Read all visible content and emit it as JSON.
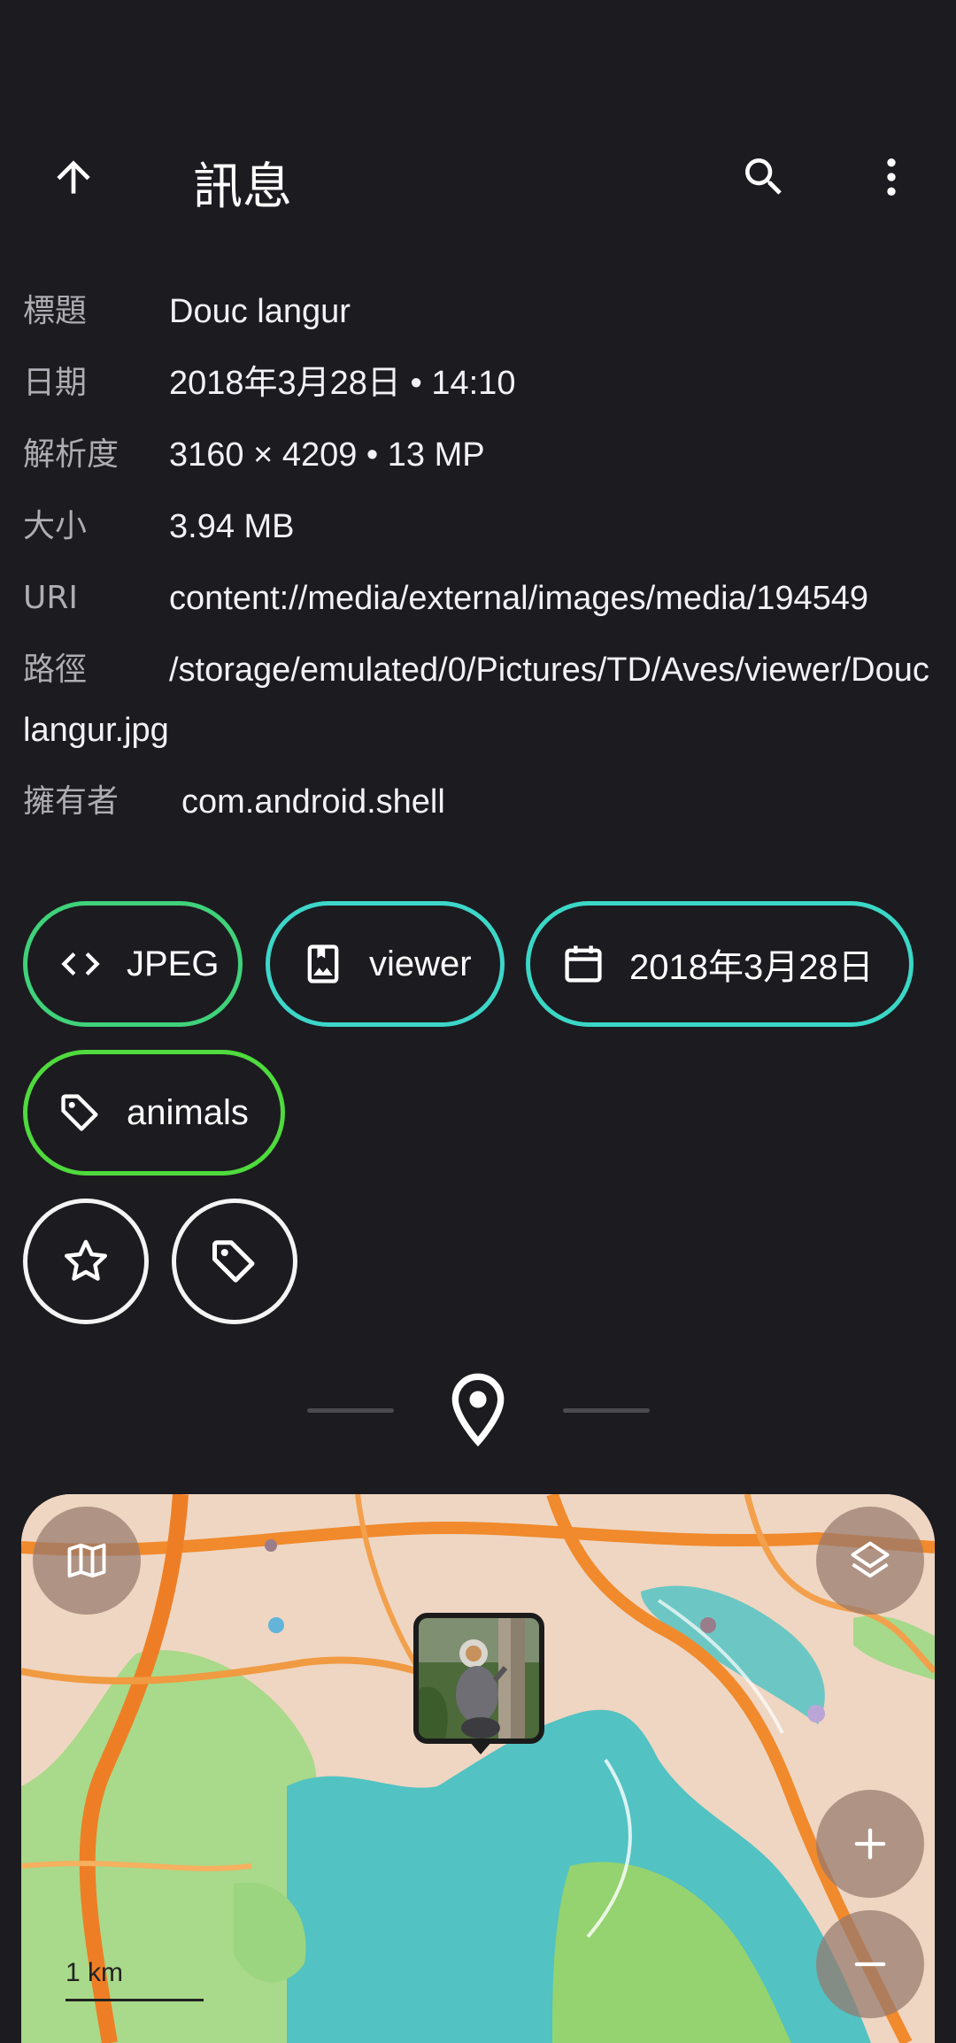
{
  "appbar": {
    "title": "訊息",
    "back_icon": "arrow-up-icon",
    "search_icon": "search-icon",
    "more_icon": "more-vert-icon"
  },
  "info": {
    "rows": [
      {
        "label": "標題",
        "value": "Douc langur"
      },
      {
        "label": "日期",
        "value": "2018年3月28日 • 14:10"
      },
      {
        "label": "解析度",
        "value": "3160 × 4209 • 13 MP"
      },
      {
        "label": "大小",
        "value": "3.94 MB"
      },
      {
        "label": "URI",
        "value": "content://media/external/images/media/194549"
      },
      {
        "label": "路徑",
        "value": "/storage/emulated/0/Pictures/TD/Aves/viewer/Douc langur.jpg"
      },
      {
        "label": "擁有者",
        "value": "com.android.shell"
      }
    ]
  },
  "chips": {
    "jpeg": {
      "label": "JPEG",
      "icon": "code-icon",
      "color": "#3fd27a"
    },
    "viewer": {
      "label": "viewer",
      "icon": "album-icon",
      "color": "#3dd6c9"
    },
    "date": {
      "label": "2018年3月28日",
      "icon": "calendar-icon",
      "color": "#3ad7c6"
    },
    "animals": {
      "label": "animals",
      "icon": "tag-icon",
      "color": "#4fda3d"
    }
  },
  "actions": {
    "favourite_icon": "star-outline-icon",
    "edit_tags_icon": "tag-outline-icon"
  },
  "location": {
    "section_icon": "location-pin-icon",
    "map": {
      "scale_label": "1 km",
      "style_icon": "map-icon",
      "layers_icon": "layers-icon",
      "zoom_in_icon": "plus-icon",
      "zoom_out_icon": "minus-icon"
    }
  },
  "colors": {
    "background": "#1c1b20",
    "label_text": "#aeadb3",
    "value_text": "#f2f1f6"
  }
}
